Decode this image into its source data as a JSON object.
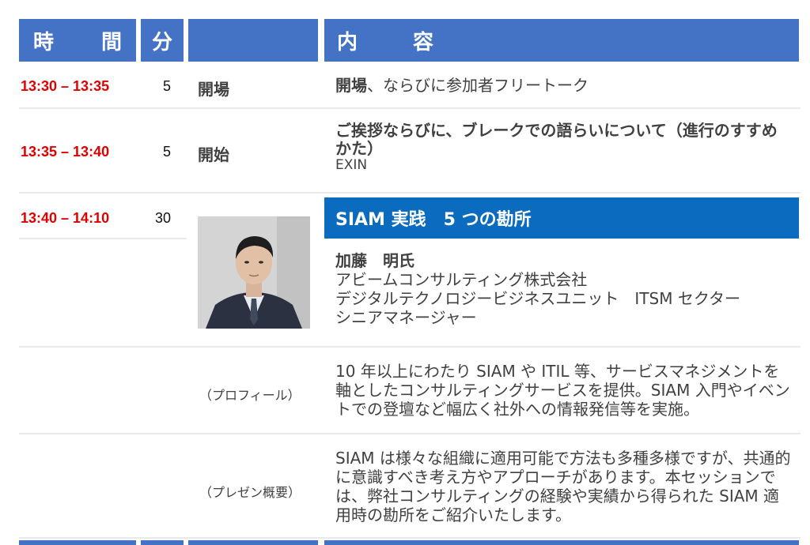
{
  "header": {
    "time_a": "時",
    "time_b": "間",
    "minutes": "分",
    "content_a": "内",
    "content_b": "容"
  },
  "rows": [
    {
      "time": "13:30 – 13:35",
      "minutes": "5",
      "label": "開場",
      "content_bold": "開場",
      "content_rest": "、ならびに参加者フリートーク"
    },
    {
      "time": "13:35 – 13:40",
      "minutes": "5",
      "label": "開始",
      "content_bold": "ご挨拶ならびに、ブレークでの語らいについて（進行のすすめかた）",
      "content_sub": "EXIN"
    },
    {
      "time": "13:40 – 14:10",
      "minutes": "30"
    }
  ],
  "session": {
    "title": "SIAM 実践　5 つの勘所",
    "speaker_name": "加藤　明氏",
    "company": "アビームコンサルティング株式会社",
    "unit": "デジタルテクノロジービジネスユニット　ITSM セクター",
    "position": "シニアマネージャー",
    "profile_label": "（プロフィール）",
    "profile_text": "10 年以上にわたり SIAM や ITIL 等、サービスマネジメントを軸としたコンサルティングサービスを提供。SIAM 入門やイベントでの登壇など幅広く社外への情報発信等を実施。",
    "summary_label": "（プレゼン概要）",
    "summary_text": "SIAM は様々な組織に適用可能で方法も多種多様ですが、共通的に意識すべき考え方やアプローチがあります。本セッションでは、弊社コンサルティングの経験や実績から得られた SIAM 適用時の勘所をご紹介いたします。"
  },
  "colors": {
    "header_bg": "#4472c4",
    "session_bar_bg": "#0a6bbf",
    "time_text": "#e00000"
  }
}
